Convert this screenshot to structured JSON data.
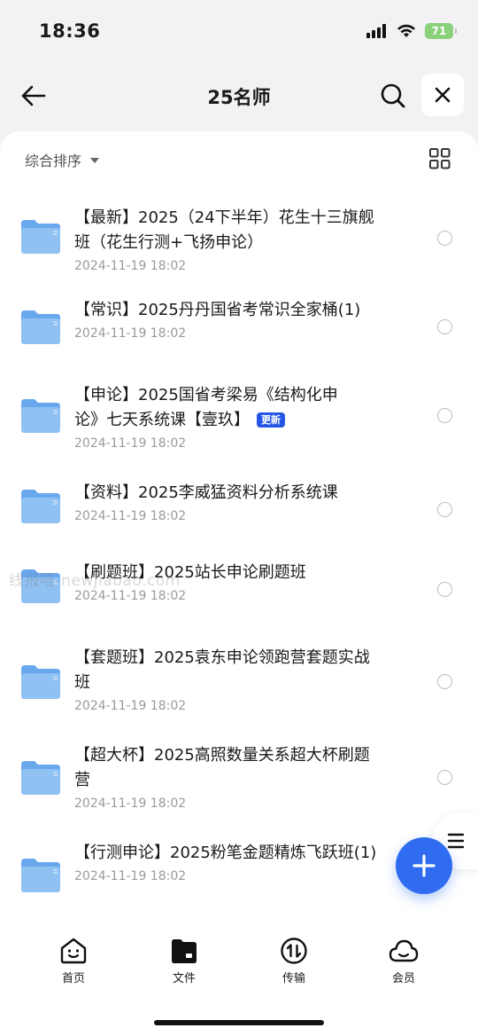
{
  "status_bar": {
    "time": "18:36",
    "battery": "71"
  },
  "nav": {
    "title": "25名师"
  },
  "toolbar": {
    "sort_label": "综合排序"
  },
  "files": [
    {
      "name": "【最新】2025（24下半年）花生十三旗舰班（花生行测+飞扬申论）",
      "date": "2024-11-19 18:02",
      "badge": ""
    },
    {
      "name": "【常识】2025丹丹国省考常识全家桶(1)",
      "date": "2024-11-19 18:02",
      "badge": ""
    },
    {
      "name": "【申论】2025国省考梁易《结构化申论》七天系统课【壹玖】",
      "date": "2024-11-19 18:02",
      "badge": "更新"
    },
    {
      "name": "【资料】2025李威猛资料分析系统课",
      "date": "2024-11-19 18:02",
      "badge": ""
    },
    {
      "name": "【刷题班】2025站长申论刷题班",
      "date": "2024-11-19 18:02",
      "badge": ""
    },
    {
      "name": "【套题班】2025袁东申论领跑营套题实战班",
      "date": "2024-11-19 18:02",
      "badge": ""
    },
    {
      "name": "【超大杯】2025高照数量关系超大杯刷题营",
      "date": "2024-11-19 18:02",
      "badge": ""
    },
    {
      "name": "【行测申论】2025粉笔金题精炼飞跃班(1)",
      "date": "2024-11-19 18:02",
      "badge": ""
    }
  ],
  "watermark": "线报喵-newjiabao.com",
  "tabs": [
    {
      "label": "首页"
    },
    {
      "label": "文件"
    },
    {
      "label": "传输"
    },
    {
      "label": "会员"
    }
  ],
  "colors": {
    "accent": "#2f6cf0",
    "badge": "#2655e6",
    "folder": "#8fc1f3"
  }
}
